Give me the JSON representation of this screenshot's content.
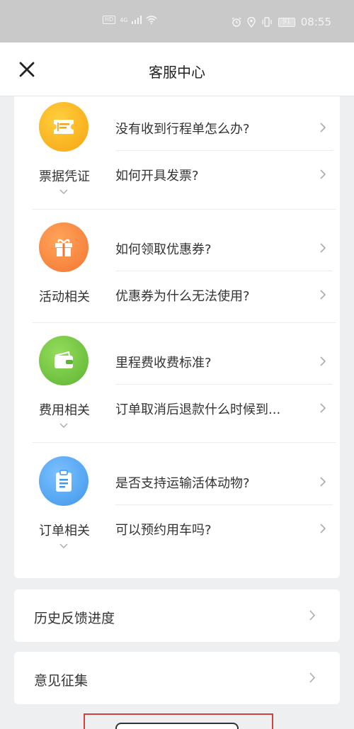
{
  "status_bar": {
    "network": "HD",
    "signal": "4G",
    "battery": "91",
    "time": "08:55"
  },
  "header": {
    "title": "客服中心",
    "close_icon": "close-icon"
  },
  "faq_sections": [
    {
      "category": "票据凭证",
      "icon": "ticket-icon",
      "icon_color": "#f9b218",
      "questions": [
        "没有收到行程单怎么办?",
        "如何开具发票?"
      ]
    },
    {
      "category": "活动相关",
      "icon": "gift-icon",
      "icon_color": "#f7843a",
      "questions": [
        "如何领取优惠券?",
        "优惠券为什么无法使用?"
      ]
    },
    {
      "category": "费用相关",
      "icon": "wallet-icon",
      "icon_color": "#72c33f",
      "questions": [
        "里程费收费标准?",
        "订单取消后退款什么时候到..."
      ]
    },
    {
      "category": "订单相关",
      "icon": "clipboard-icon",
      "icon_color": "#4fa3ef",
      "questions": [
        "是否支持运输活体动物?",
        "可以预约用车吗?"
      ]
    }
  ],
  "links": {
    "feedback_progress": "历史反馈进度",
    "suggestions": "意见征集"
  }
}
